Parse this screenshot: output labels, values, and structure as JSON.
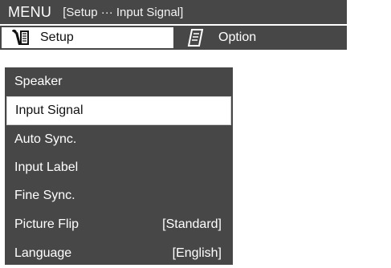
{
  "title_bar": {
    "menu_label": "MENU",
    "breadcrumb": "[Setup ··· Input Signal]"
  },
  "tabs": [
    {
      "label": "Setup",
      "icon": "wrench-icon",
      "active": true
    },
    {
      "label": "Option",
      "icon": "memo-icon",
      "active": false
    }
  ],
  "menu": {
    "items": [
      {
        "label": "Speaker",
        "value": ""
      },
      {
        "label": "Input Signal",
        "value": "",
        "selected": true
      },
      {
        "label": "Auto Sync.",
        "value": ""
      },
      {
        "label": "Input Label",
        "value": ""
      },
      {
        "label": "Fine Sync.",
        "value": ""
      },
      {
        "label": "Picture Flip",
        "value": "[Standard]"
      },
      {
        "label": "Language",
        "value": "[English]"
      }
    ]
  },
  "colors": {
    "bar": "#474747",
    "selected_bg": "#ffffff",
    "text_light": "#ffffff",
    "text_dark": "#111111"
  }
}
